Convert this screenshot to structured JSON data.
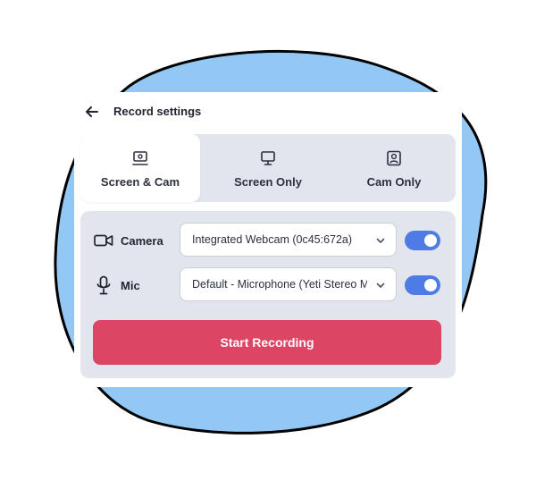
{
  "colors": {
    "blob_fill": "#93c8f4",
    "blob_stroke": "#000000",
    "accent_toggle": "#4e7be6",
    "primary_button": "#dc4564",
    "panel_bg": "#e2e6ec"
  },
  "header": {
    "back_icon": "arrow-left-icon",
    "title": "Record settings"
  },
  "tabs": [
    {
      "label": "Screen & Cam",
      "icon": "screen-cam-icon",
      "active": true
    },
    {
      "label": "Screen Only",
      "icon": "monitor-icon",
      "active": false
    },
    {
      "label": "Cam Only",
      "icon": "user-portrait-icon",
      "active": false
    }
  ],
  "camera": {
    "label": "Camera",
    "icon": "video-camera-icon",
    "selected": "Integrated Webcam (0c45:672a)",
    "enabled": true
  },
  "mic": {
    "label": "Mic",
    "icon": "microphone-icon",
    "selected": "Default - Microphone (Yeti Stereo Microphone)",
    "enabled": true
  },
  "start_button": {
    "label": "Start Recording"
  }
}
